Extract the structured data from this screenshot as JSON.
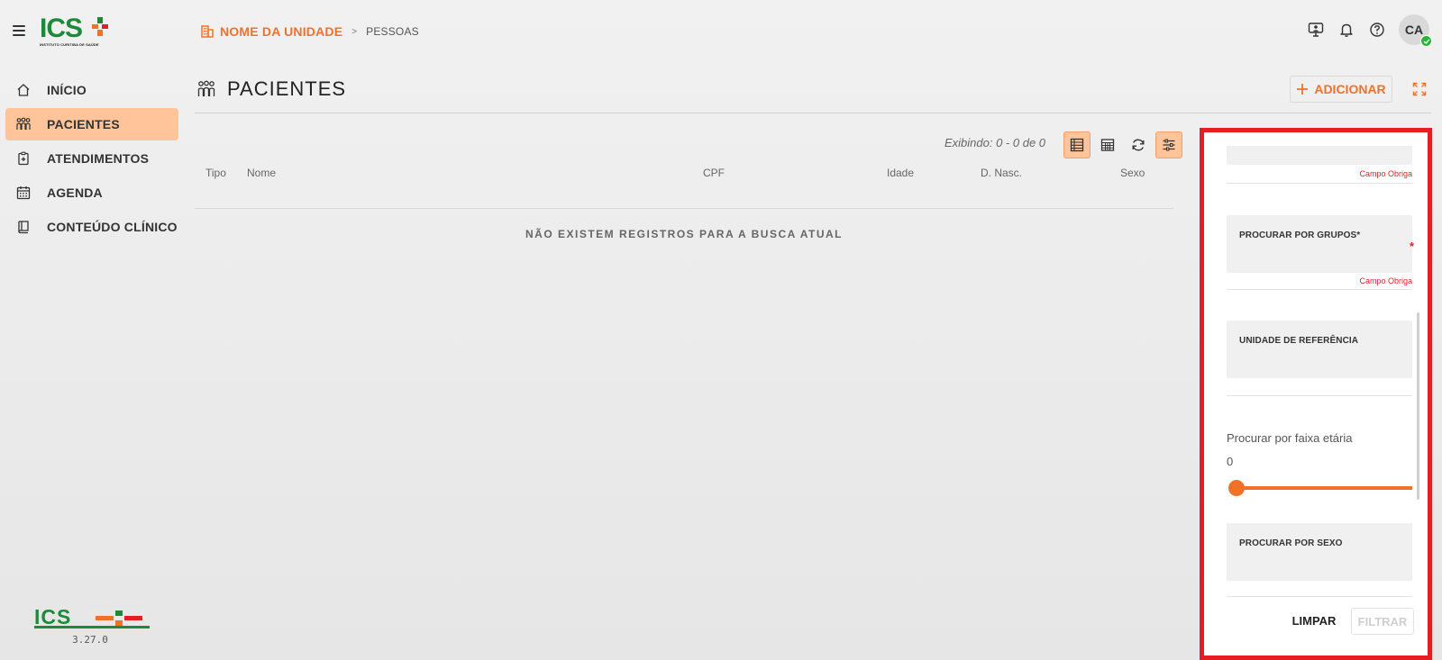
{
  "brand": {
    "logo_text": "ICS",
    "logo_subtitle": "INSTITUTO CURITIBA DE SAÚDE",
    "version": "3.27.0",
    "colors": {
      "accent": "#f07228",
      "active_bg": "#ffc49a",
      "brand_green": "#1d8a3a",
      "error": "#e51e25"
    }
  },
  "header": {
    "menu_icon": "hamburger-icon",
    "breadcrumb": {
      "unit": "NOME DA UNIDADE",
      "separator": ">",
      "page": "PESSOAS"
    },
    "user_initials": "CA"
  },
  "sidebar": {
    "items": [
      {
        "label": "INÍCIO",
        "icon": "home-icon",
        "active": false
      },
      {
        "label": "PACIENTES",
        "icon": "people-icon",
        "active": true
      },
      {
        "label": "ATENDIMENTOS",
        "icon": "clipboard-icon",
        "active": false
      },
      {
        "label": "AGENDA",
        "icon": "calendar-icon",
        "active": false
      },
      {
        "label": "CONTEÚDO CLÍNICO",
        "icon": "book-icon",
        "active": false
      }
    ]
  },
  "main": {
    "title": "PACIENTES",
    "add_label": "ADICIONAR",
    "showing": "Exibindo: 0 - 0 de 0",
    "columns": [
      "Tipo",
      "Nome",
      "CPF",
      "Idade",
      "D. Nasc.",
      "Sexo"
    ],
    "empty_message": "NÃO EXISTEM REGISTROS PARA A BUSCA ATUAL"
  },
  "filters": {
    "required_error": "Campo Obriga",
    "groups_label": "PROCURAR POR GRUPOS*",
    "reference_unit_label": "UNIDADE DE REFERÊNCIA",
    "age_range_label": "Procurar por faixa etária",
    "age_min": "0",
    "age_range_fraction": [
      0,
      1
    ],
    "sex_label": "PROCURAR POR SEXO",
    "clear_label": "LIMPAR",
    "filter_label": "FILTRAR"
  }
}
